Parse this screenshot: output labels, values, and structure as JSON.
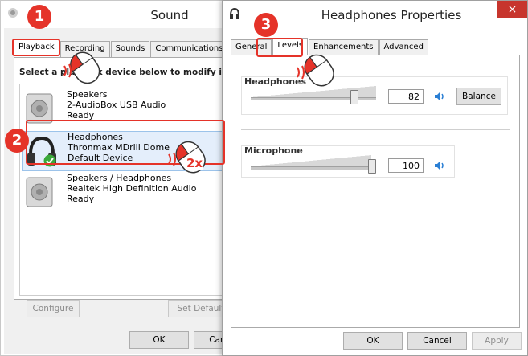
{
  "sound_window": {
    "title": "Sound",
    "tabs": [
      "Playback",
      "Recording",
      "Sounds",
      "Communications"
    ],
    "instruction": "Select a playback device below to modify its settings:",
    "devices": [
      {
        "line1": "Speakers",
        "line2": "2-AudioBox USB Audio",
        "line3": "Ready",
        "icon": "speaker-icon"
      },
      {
        "line1": "Headphones",
        "line2": "Thronmax MDrill Dome",
        "line3": "Default Device",
        "icon": "headphones-icon"
      },
      {
        "line1": "Speakers / Headphones",
        "line2": "Realtek High Definition Audio",
        "line3": "Ready",
        "icon": "speaker-icon"
      }
    ],
    "configure_label": "Configure",
    "set_default_label": "Set Default",
    "ok_label": "OK",
    "cancel_label": "Cancel"
  },
  "props_window": {
    "title": "Headphones Properties",
    "close_glyph": "×",
    "tabs": [
      "General",
      "Levels",
      "Enhancements",
      "Advanced"
    ],
    "headphones_label": "Headphones",
    "headphones_value": "82",
    "headphones_level": 82,
    "balance_label": "Balance",
    "microphone_label": "Microphone",
    "microphone_value": "100",
    "microphone_level": 100,
    "ok_label": "OK",
    "cancel_label": "Cancel",
    "apply_label": "Apply"
  },
  "annotations": {
    "step1": "1",
    "step2": "2",
    "step3": "3",
    "double_click": "2x"
  },
  "colors": {
    "annotation_red": "#e53329",
    "close_red": "#c7352d",
    "selection_blue": "#e4eefb"
  }
}
